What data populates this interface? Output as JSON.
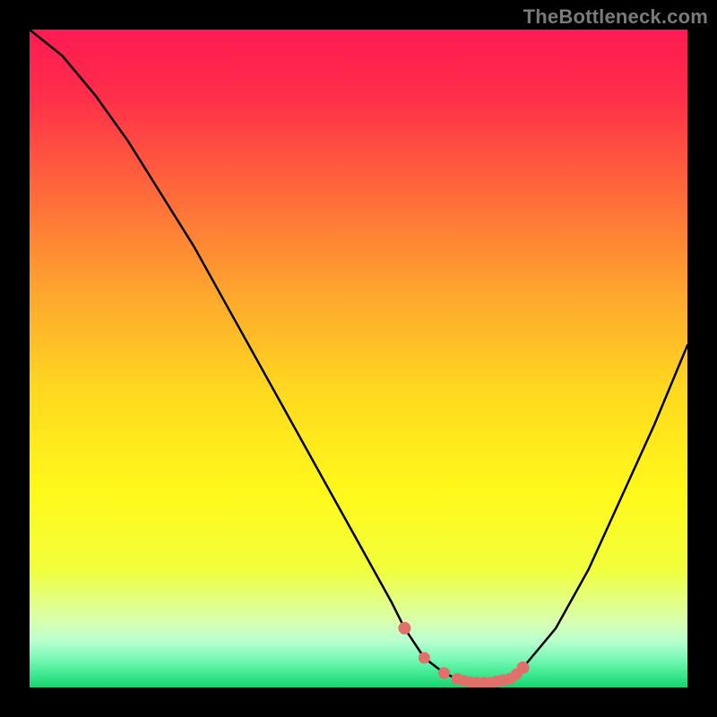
{
  "watermark": "TheBottleneck.com",
  "colors": {
    "frame": "#000000",
    "watermark": "#7a7a7a",
    "curve": "#000000",
    "marker": "#e2706a",
    "gradient_stops": [
      {
        "offset": 0.0,
        "color": "#ff1a53"
      },
      {
        "offset": 0.1,
        "color": "#ff2e4a"
      },
      {
        "offset": 0.25,
        "color": "#ff6a3a"
      },
      {
        "offset": 0.4,
        "color": "#ffa62e"
      },
      {
        "offset": 0.55,
        "color": "#ffd91f"
      },
      {
        "offset": 0.7,
        "color": "#fff81a"
      },
      {
        "offset": 0.82,
        "color": "#f2ff3a"
      },
      {
        "offset": 0.9,
        "color": "#d8ffb0"
      },
      {
        "offset": 0.93,
        "color": "#b8ffd0"
      },
      {
        "offset": 0.96,
        "color": "#70f7b0"
      },
      {
        "offset": 0.98,
        "color": "#3de890"
      },
      {
        "offset": 1.0,
        "color": "#17d46f"
      }
    ]
  },
  "chart_data": {
    "type": "line",
    "title": "",
    "xlabel": "",
    "ylabel": "",
    "xlim": [
      0,
      100
    ],
    "ylim": [
      0,
      100
    ],
    "series": [
      {
        "name": "bottleneck-curve",
        "x": [
          0,
          5,
          10,
          15,
          20,
          25,
          30,
          35,
          40,
          45,
          50,
          55,
          57,
          60,
          63,
          65,
          68,
          70,
          73,
          75,
          80,
          85,
          90,
          95,
          100
        ],
        "y": [
          100,
          96,
          90,
          83,
          75,
          67,
          58,
          49,
          40,
          31,
          22,
          13,
          9,
          4.5,
          2.2,
          1.3,
          0.7,
          0.7,
          1.3,
          3,
          9,
          18,
          29,
          40,
          52
        ]
      }
    ],
    "markers": {
      "name": "optimal-zone",
      "x": [
        57,
        60,
        63,
        65,
        66,
        67,
        68,
        69,
        70,
        71,
        72,
        73,
        74,
        75
      ],
      "y": [
        9,
        4.5,
        2.2,
        1.3,
        1.0,
        0.8,
        0.7,
        0.7,
        0.7,
        0.9,
        1.1,
        1.3,
        2.0,
        3.0
      ]
    }
  }
}
